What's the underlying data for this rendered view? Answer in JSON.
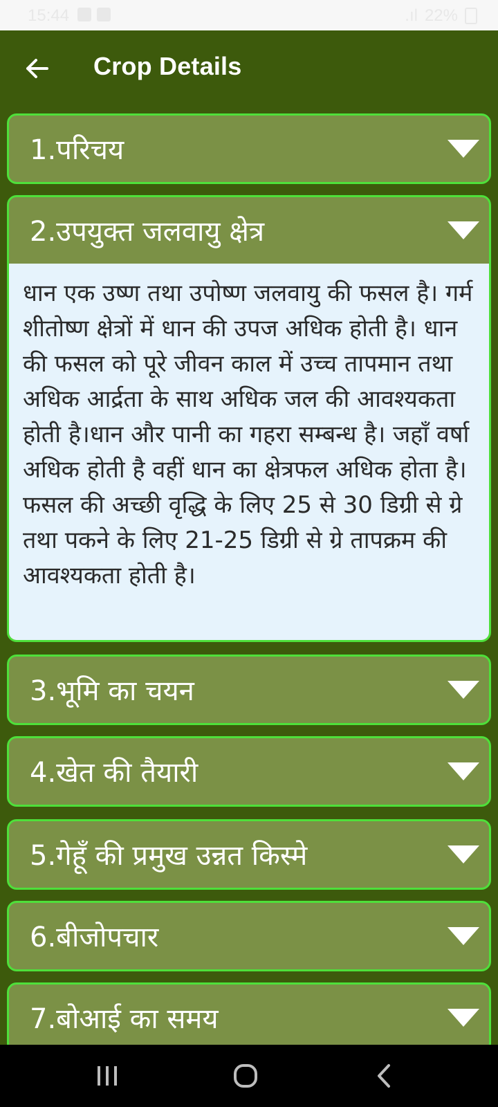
{
  "status_bar": {
    "time": "15:44",
    "battery": "22%"
  },
  "app_bar": {
    "title": "Crop Details",
    "back_icon": "arrow-left-icon"
  },
  "sections": [
    {
      "title": "1.परिचय",
      "expanded": false
    },
    {
      "title": "2.उपयुक्त जलवायु क्षेत्र",
      "expanded": true,
      "body": "धान एक उष्ण तथा उपोष्ण जलवायु की फसल है। गर्म शीतोष्ण क्षेत्रों में धान की उपज अधिक होती है। धान की फसल को पूरे जीवन काल में उच्च तापमान तथा अधिक आर्द्रता के साथ अधिक जल की आवश्यकता होती है।धान और पानी का गहरा सम्बन्ध है। जहाँ वर्षा अधिक होती है वहीं धान का क्षेत्रफल अधिक होता है। फसल की अच्छी वृद्धि के लिए 25 से 30 डिग्री से ग्रे तथा पकने के लिए 21-25 डिग्री से ग्रे तापक्रम की आवश्यकता होती है।"
    },
    {
      "title": "3.भूमि का चयन",
      "expanded": false
    },
    {
      "title": "4.खेत की तैयारी",
      "expanded": false
    },
    {
      "title": "5.गेहूँ की प्रमुख उन्नत किस्मे",
      "expanded": false
    },
    {
      "title": "6.बीजोपचार",
      "expanded": false
    },
    {
      "title": "7.बोआई का समय",
      "expanded": false
    }
  ],
  "colors": {
    "app_bar_bg": "#3d5a0c",
    "section_bg": "#7b9146",
    "section_border": "#4ee03a",
    "body_bg": "#e6f3fc"
  },
  "nav_bar": {
    "recents_icon": "recents-icon",
    "home_icon": "home-icon",
    "back_icon": "nav-back-icon"
  }
}
